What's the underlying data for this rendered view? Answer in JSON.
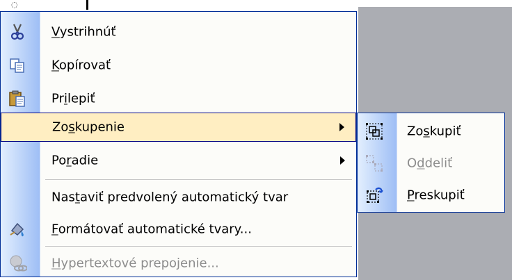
{
  "context_menu": {
    "items": [
      {
        "name": "cut",
        "pre": "",
        "key": "V",
        "post": "ystrihnúť",
        "disabled": false
      },
      {
        "name": "copy",
        "pre": "",
        "key": "K",
        "post": "opírovať",
        "disabled": false
      },
      {
        "name": "paste",
        "pre": "Pr",
        "key": "i",
        "post": "lepiť",
        "disabled": false
      },
      {
        "name": "group",
        "pre": "Zo",
        "key": "s",
        "post": "kupenie",
        "disabled": false
      },
      {
        "name": "order",
        "pre": "Po",
        "key": "r",
        "post": "adie",
        "disabled": false
      },
      {
        "name": "set-default-autoshape",
        "pre": "Nas",
        "key": "t",
        "post": "aviť predvolený automatický tvar",
        "disabled": false
      },
      {
        "name": "format-autoshapes",
        "pre": "",
        "key": "F",
        "post": "ormátovať automatické tvary...",
        "disabled": false
      },
      {
        "name": "hyperlink",
        "pre": "",
        "key": "H",
        "post": "ypertextové prepojenie...",
        "disabled": true
      }
    ]
  },
  "submenu": {
    "items": [
      {
        "name": "group-shapes",
        "pre": "Zo",
        "key": "s",
        "post": "kupiť",
        "disabled": false
      },
      {
        "name": "ungroup",
        "pre": "O",
        "key": "d",
        "post": "deliť",
        "disabled": true
      },
      {
        "name": "regroup",
        "pre": "",
        "key": "P",
        "post": "reskupiť",
        "disabled": false
      }
    ]
  },
  "icons": {
    "cut": "scissors-icon",
    "copy": "copy-icon",
    "paste": "paste-icon",
    "format": "paint-format-icon",
    "hyperlink": "hyperlink-icon",
    "group": "group-icon",
    "ungroup": "ungroup-icon",
    "regroup": "regroup-icon"
  },
  "colors": {
    "menu_border": "#002d96",
    "highlight": "#ffeec2",
    "disabled_text": "#8d8d8d",
    "desktop_gray": "#abadb3"
  }
}
